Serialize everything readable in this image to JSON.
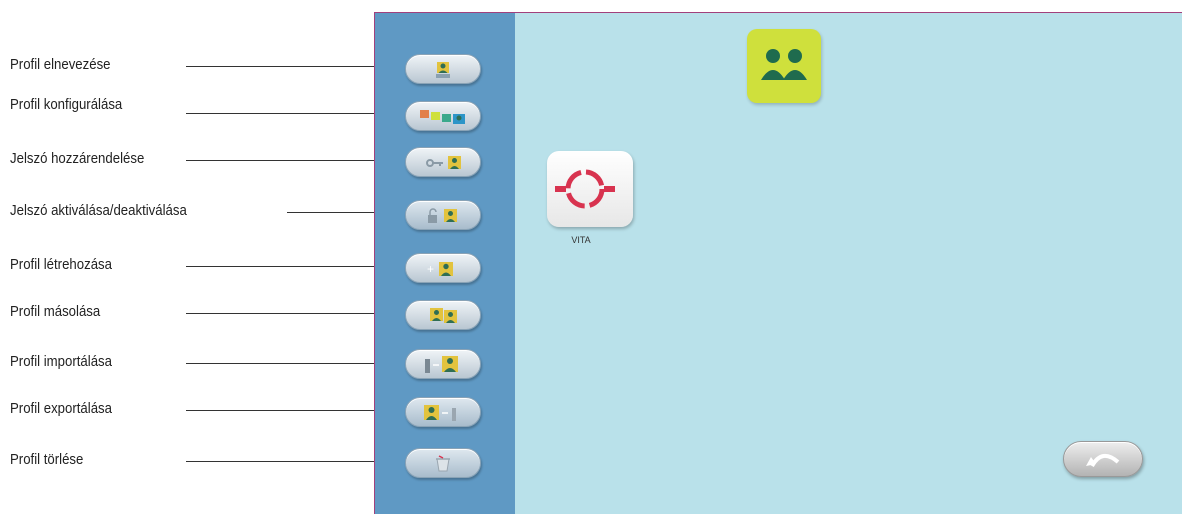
{
  "labels": [
    "Profil elnevezése",
    "Profil konfigurálása",
    "Jelszó hozzárendelése",
    "Jelszó aktiválása/deaktiválása",
    "Profil létrehozása",
    "Profil másolása",
    "Profil importálása",
    "Profil exportálása",
    "Profil törlése"
  ],
  "sidebar": {
    "buttons": [
      {
        "icon": "name-profile-icon"
      },
      {
        "icon": "configure-profile-icon"
      },
      {
        "icon": "key-assign-icon"
      },
      {
        "icon": "lock-toggle-icon"
      },
      {
        "icon": "add-profile-icon"
      },
      {
        "icon": "copy-profile-icon"
      },
      {
        "icon": "import-profile-icon"
      },
      {
        "icon": "export-profile-icon"
      },
      {
        "icon": "trash-icon"
      }
    ]
  },
  "main": {
    "profile_icon": "two-users-icon",
    "app": {
      "name": "VITA",
      "icon": "vita-ring-icon"
    },
    "back_icon": "undo-arrow-icon"
  },
  "colors": {
    "sidebar": "#5f99c4",
    "main_bg": "#b9e1ea",
    "profile_tile": "#cfe03c",
    "vita_red": "#d8334f",
    "frame": "#a2407c"
  }
}
